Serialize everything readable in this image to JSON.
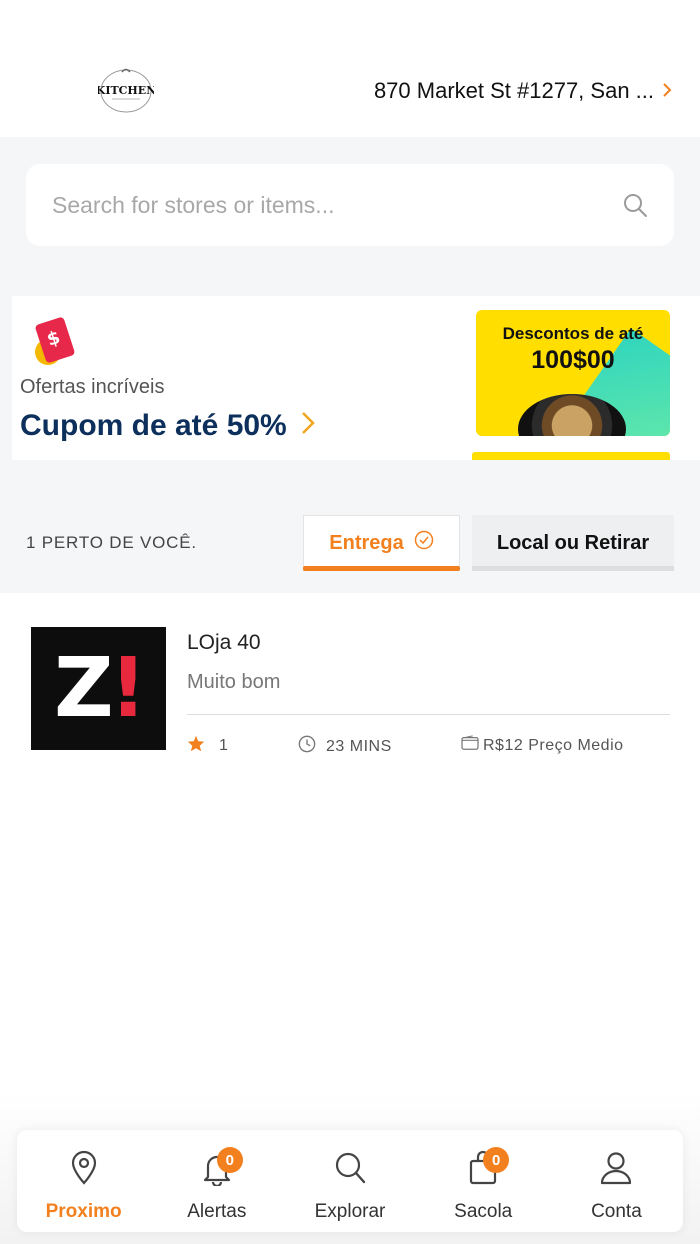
{
  "header": {
    "logo_text": "KITCHEN",
    "address": "870 Market St #1277, San ...",
    "address_chevron_icon": "chevron-right-icon"
  },
  "search": {
    "placeholder": "Search for stores or items...",
    "icon": "search-icon"
  },
  "promo": {
    "icon": "coupon-icon",
    "subtitle": "Ofertas incríveis",
    "title": "Cupom de até 50%",
    "chevron_icon": "chevron-right-icon",
    "banner_line1": "Descontos de até",
    "banner_line2": "100$00"
  },
  "filter": {
    "near_label": "1 PERTO DE VOCÊ.",
    "tabs": [
      {
        "label": "Entrega",
        "active": true,
        "icon": "check-circle-icon"
      },
      {
        "label": "Local ou Retirar",
        "active": false
      }
    ]
  },
  "stores": [
    {
      "logo_text": "Z!",
      "name": "LOja 40",
      "description": "Muito bom",
      "rating": "1",
      "time": "23 MINS",
      "price": "R$12 Preço Medio"
    }
  ],
  "tabbar": {
    "items": [
      {
        "label": "Proximo",
        "icon": "location-pin-icon",
        "active": true
      },
      {
        "label": "Alertas",
        "icon": "bell-icon",
        "badge": "0"
      },
      {
        "label": "Explorar",
        "icon": "search-icon"
      },
      {
        "label": "Sacola",
        "icon": "bag-icon",
        "badge": "0"
      },
      {
        "label": "Conta",
        "icon": "user-icon"
      }
    ]
  },
  "colors": {
    "accent": "#f2801f",
    "promo_title": "#0c2f5c",
    "banner": "#ffde00"
  }
}
